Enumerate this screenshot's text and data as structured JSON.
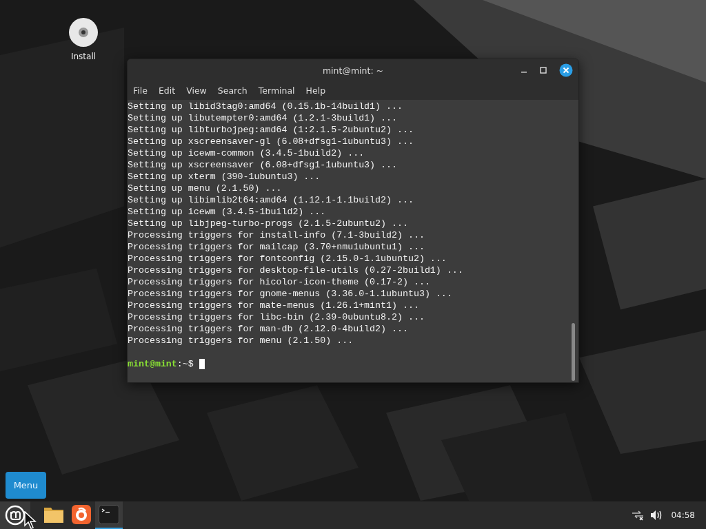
{
  "desktop_icons": [
    {
      "label": "Install"
    }
  ],
  "window": {
    "title": "mint@mint: ~",
    "menu": [
      "File",
      "Edit",
      "View",
      "Search",
      "Terminal",
      "Help"
    ],
    "lines": [
      "Setting up libid3tag0:amd64 (0.15.1b-14build1) ...",
      "Setting up libutempter0:amd64 (1.2.1-3build1) ...",
      "Setting up libturbojpeg:amd64 (1:2.1.5-2ubuntu2) ...",
      "Setting up xscreensaver-gl (6.08+dfsg1-1ubuntu3) ...",
      "Setting up icewm-common (3.4.5-1build2) ...",
      "Setting up xscreensaver (6.08+dfsg1-1ubuntu3) ...",
      "Setting up xterm (390-1ubuntu3) ...",
      "Setting up menu (2.1.50) ...",
      "Setting up libimlib2t64:amd64 (1.12.1-1.1build2) ...",
      "Setting up icewm (3.4.5-1build2) ...",
      "Setting up libjpeg-turbo-progs (2.1.5-2ubuntu2) ...",
      "Processing triggers for install-info (7.1-3build2) ...",
      "Processing triggers for mailcap (3.70+nmu1ubuntu1) ...",
      "Processing triggers for fontconfig (2.15.0-1.1ubuntu2) ...",
      "Processing triggers for desktop-file-utils (0.27-2build1) ...",
      "Processing triggers for hicolor-icon-theme (0.17-2) ...",
      "Processing triggers for gnome-menus (3.36.0-1.1ubuntu3) ...",
      "Processing triggers for mate-menus (1.26.1+mint1) ...",
      "Processing triggers for libc-bin (2.39-0ubuntu8.2) ...",
      "Processing triggers for man-db (2.12.0-4build2) ...",
      "Processing triggers for menu (2.1.50) ..."
    ],
    "prompt": {
      "user_host": "mint@mint",
      "path": ":~$"
    }
  },
  "tooltip": {
    "text": "Menu"
  },
  "taskbar": {
    "launchers": [
      {
        "kind": "files",
        "selected": false
      },
      {
        "kind": "browser",
        "selected": false
      },
      {
        "kind": "terminal",
        "selected": true
      }
    ],
    "clock": "04:58"
  }
}
